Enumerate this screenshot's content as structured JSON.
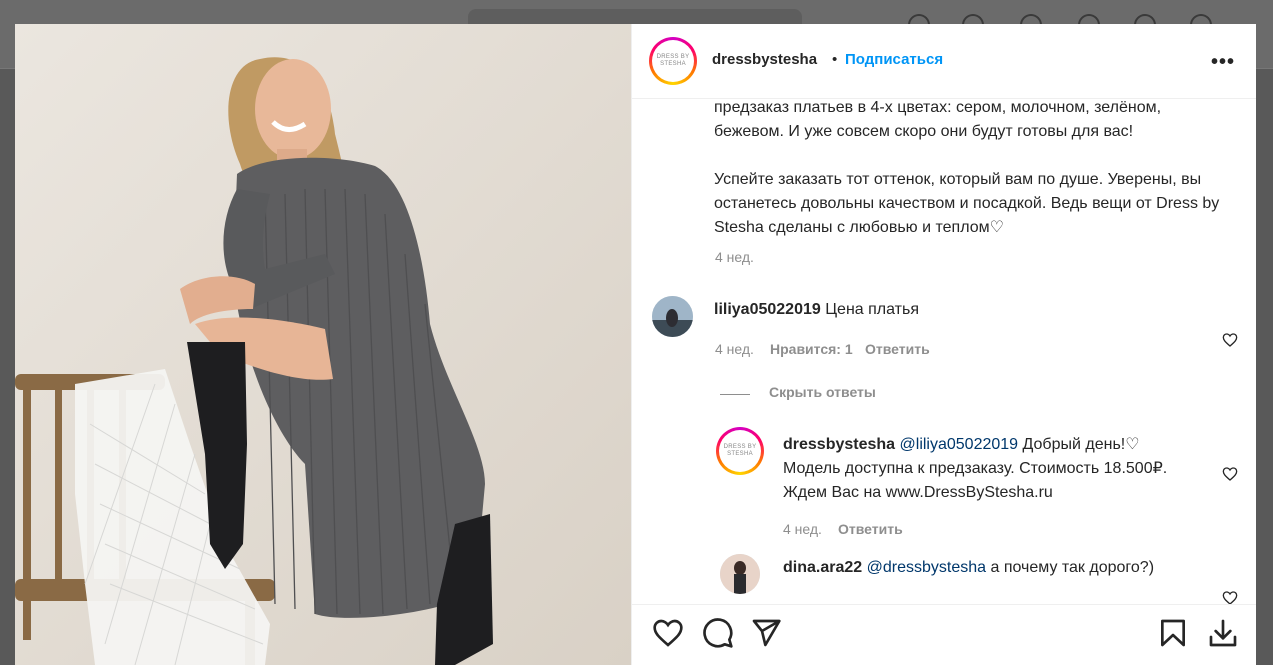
{
  "post": {
    "username": "dressbystesha",
    "separator": "•",
    "follow_label": "Подписаться",
    "more_label": "•••",
    "avatar_text": "DRESS BY STESHA"
  },
  "caption": {
    "text": "предзаказ платьев в 4-х цветах: сером, молочном, зелёном, бежевом. И уже совсем скоро они будут готовы для вас!\n\nУспейте заказать тот оттенок, который вам по душе. Уверены, вы останетесь довольны качеством и посадкой. Ведь вещи от Dress by Stesha сделаны с любовью и теплом♡",
    "age": "4 нед."
  },
  "comments": [
    {
      "username": "liliya05022019",
      "text": "Цена платья",
      "age": "4 нед.",
      "likes": "Нравится: 1",
      "reply_label": "Ответить"
    }
  ],
  "hide_replies_label": "Скрыть ответы",
  "replies": [
    {
      "username": "dressbystesha",
      "mention": "@liliya05022019",
      "text_line1": "Добрый день!♡",
      "text_line2": "Модель доступна к предзаказу. Стоимость 18.500₽.",
      "text_line3": "Ждем Вас на www.DressByStesha.ru",
      "age": "4 нед.",
      "reply_label": "Ответить"
    },
    {
      "username": "dina.ara22",
      "mention": "@dressbystesha",
      "text": "а почему так дорого?)"
    }
  ],
  "icons": [
    "heart-icon",
    "comment-icon",
    "share-icon",
    "bookmark-icon",
    "download-icon",
    "more-icon"
  ],
  "colors": {
    "link_blue": "#0095f6",
    "mention": "#00376b",
    "muted": "#8e8e8e",
    "text": "#262626"
  }
}
